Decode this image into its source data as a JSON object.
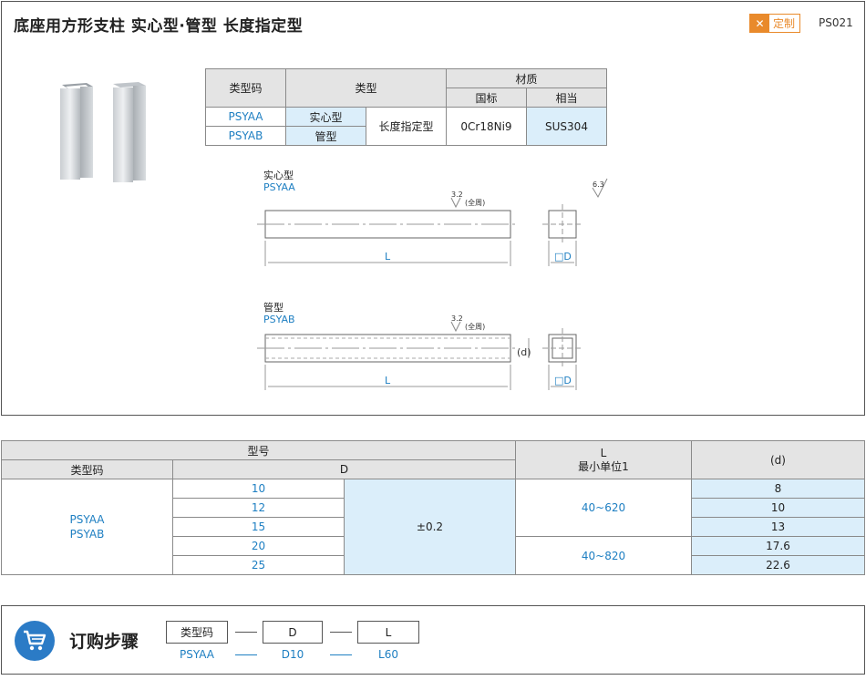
{
  "header": {
    "title": "底座用方形支柱  实心型·管型  长度指定型",
    "badge_label": "定制",
    "code": "PS021"
  },
  "spec_table": {
    "h_type_code": "类型码",
    "h_type": "类型",
    "h_material": "材质",
    "h_gb": "国标",
    "h_equiv": "相当",
    "rows": [
      {
        "code": "PSYAA",
        "type": "实心型"
      },
      {
        "code": "PSYAB",
        "type": "管型"
      }
    ],
    "length_type": "长度指定型",
    "gb": "0Cr18Ni9",
    "equiv": "SUS304"
  },
  "drawing": {
    "solid_label": "实心型",
    "solid_code": "PSYAA",
    "pipe_label": "管型",
    "pipe_code": "PSYAB",
    "roughness_main": "3.2",
    "roughness_all": "(全周)",
    "roughness_general": "6.3",
    "dim_L": "L",
    "dim_D": "□D",
    "dim_d": "(d)"
  },
  "size_table": {
    "h_model": "型号",
    "h_type_code": "类型码",
    "h_D": "D",
    "h_L": "L",
    "h_L_unit": "最小单位1",
    "h_d": "(d)",
    "codes": [
      "PSYAA",
      "PSYAB"
    ],
    "D_values": [
      "10",
      "12",
      "15",
      "20",
      "25"
    ],
    "tolerance": "±0.2",
    "L_ranges": [
      "40~620",
      "40~820"
    ],
    "d_values": [
      "8",
      "10",
      "13",
      "17.6",
      "22.6"
    ]
  },
  "order": {
    "title": "订购步骤",
    "fields": [
      "类型码",
      "D",
      "L"
    ],
    "example": [
      "PSYAA",
      "D10",
      "L60"
    ]
  },
  "colors": {
    "accent": "#1e7fc2",
    "badge": "#e98a2b",
    "highlight": "#dbeefa"
  }
}
